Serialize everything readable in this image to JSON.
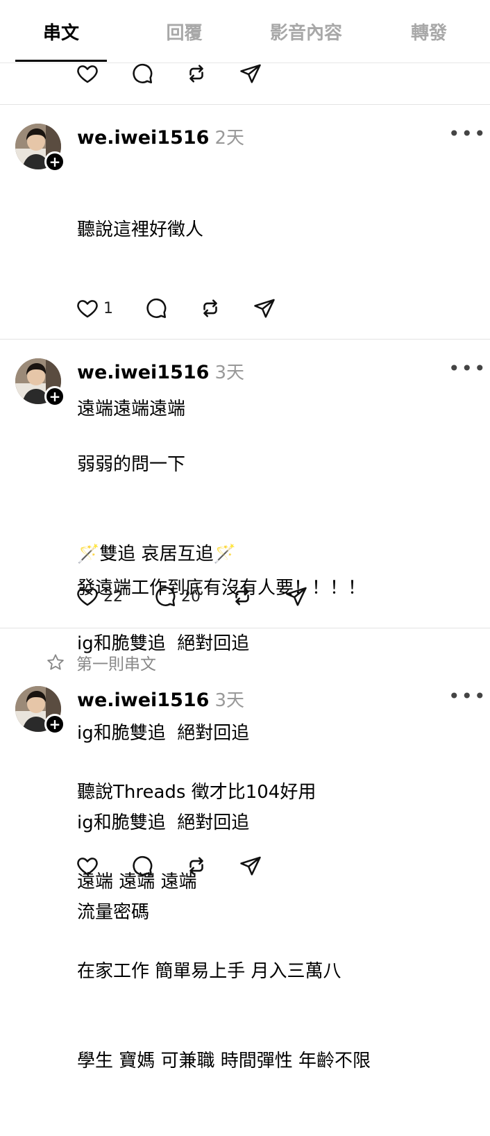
{
  "tabs": [
    {
      "label": "串文",
      "active": true
    },
    {
      "label": "回覆",
      "active": false
    },
    {
      "label": "影音內容",
      "active": false
    },
    {
      "label": "轉發",
      "active": false
    }
  ],
  "top_actions": {
    "icons": [
      "heart-icon",
      "comment-icon",
      "repost-icon",
      "share-icon"
    ]
  },
  "posts": [
    {
      "username": "we.iwei1516",
      "time": "2天",
      "lines": [
        "聽說這裡好徵人",
        "",
        "遠端遠端遠端",
        "",
        "發遠端工作到底有沒有人要！！！！"
      ],
      "likes": "1",
      "comments": ""
    },
    {
      "username": "we.iwei1516",
      "time": "3天",
      "lines": [
        "弱弱的問一下",
        "🪄雙追 哀居互追🪄",
        "ig和脆雙追  絕對回追",
        "ig和脆雙追  絕對回追",
        "ig和脆雙追  絕對回追",
        "流量密碼"
      ],
      "likes": "22",
      "comments": "20"
    },
    {
      "pinned_label": "第一則串文",
      "username": "we.iwei1516",
      "time": "3天",
      "lines": [
        "聽說Threads 徵才比104好用",
        "遠端 遠端 遠端",
        "在家工作 簡單易上手 月入三萬八",
        "學生 寶媽 可兼職 時間彈性 年齡不限"
      ],
      "likes": "",
      "comments": ""
    }
  ],
  "colors": {
    "text": "#000000",
    "muted": "#999999",
    "inactive_tab": "#a8a8a8",
    "divider": "#e3e3e3"
  }
}
